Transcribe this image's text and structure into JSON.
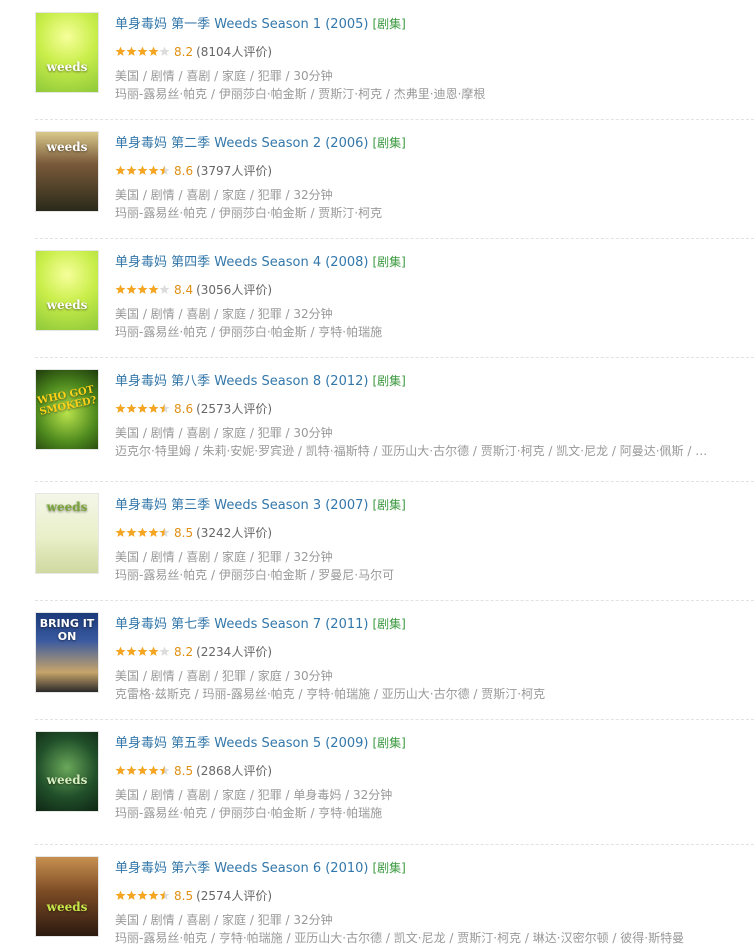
{
  "colors": {
    "title": "#3377aa",
    "tag": "#3b9940",
    "score": "#e09015",
    "meta": "#999999",
    "star": "#f4a522"
  },
  "items": [
    {
      "title": "单身毒妈 第一季 Weeds Season 1 (2005)",
      "tag": "[剧集]",
      "stars": 4,
      "score": "8.2",
      "count": "(8104人评价)",
      "genre": "美国 / 剧情 / 喜剧 / 家庭 / 犯罪 / 30分钟",
      "cast": "玛丽-露易丝·帕克 / 伊丽莎白·帕金斯 / 贾斯汀·柯克 / 杰弗里·迪恩·摩根",
      "poster": "leaf-lime",
      "poster_text": "weeds"
    },
    {
      "title": "单身毒妈 第二季 Weeds Season 2 (2006)",
      "tag": "[剧集]",
      "stars": 4.5,
      "score": "8.6",
      "count": "(3797人评价)",
      "genre": "美国 / 剧情 / 喜剧 / 家庭 / 犯罪 / 32分钟",
      "cast": "玛丽-露易丝·帕克 / 伊丽莎白·帕金斯 / 贾斯汀·柯克",
      "poster": "group-dark",
      "poster_text": "weeds"
    },
    {
      "title": "单身毒妈 第四季 Weeds Season 4 (2008)",
      "tag": "[剧集]",
      "stars": 4,
      "score": "8.4",
      "count": "(3056人评价)",
      "genre": "美国 / 剧情 / 喜剧 / 家庭 / 犯罪 / 32分钟",
      "cast": "玛丽-露易丝·帕克 / 伊丽莎白·帕金斯 / 亨特·帕瑞施",
      "poster": "leaf-lime",
      "poster_text": "weeds"
    },
    {
      "title": "单身毒妈 第八季 Weeds Season 8 (2012)",
      "tag": "[剧集]",
      "stars": 4.5,
      "score": "8.6",
      "count": "(2573人评价)",
      "genre": "美国 / 剧情 / 喜剧 / 家庭 / 犯罪 / 30分钟",
      "cast": "迈克尔·特里姆 / 朱莉·安妮·罗宾逊 / 凯特·福斯特 / 亚历山大·古尔德 / 贾斯汀·柯克 / 凯文·尼龙 / 阿曼达·佩斯 / 瑞…",
      "poster": "green-smoke",
      "poster_text": "WHO GOT SMOKED?"
    },
    {
      "title": "单身毒妈 第三季 Weeds Season 3 (2007)",
      "tag": "[剧集]",
      "stars": 4.5,
      "score": "8.5",
      "count": "(3242人评价)",
      "genre": "美国 / 剧情 / 喜剧 / 家庭 / 犯罪 / 32分钟",
      "cast": "玛丽-露易丝·帕克 / 伊丽莎白·帕金斯 / 罗曼尼·马尔可",
      "poster": "white-group",
      "poster_text": "weeds"
    },
    {
      "title": "单身毒妈 第七季 Weeds Season 7 (2011)",
      "tag": "[剧集]",
      "stars": 4,
      "score": "8.2",
      "count": "(2234人评价)",
      "genre": "美国 / 剧情 / 喜剧 / 犯罪 / 家庭 / 30分钟",
      "cast": "克雷格·兹斯克 / 玛丽-露易丝·帕克 / 亨特·帕瑞施 / 亚历山大·古尔德 / 贾斯汀·柯克",
      "poster": "bring-it",
      "poster_text": "BRING IT ON"
    },
    {
      "title": "单身毒妈 第五季 Weeds Season 5 (2009)",
      "tag": "[剧集]",
      "stars": 4.5,
      "score": "8.5",
      "count": "(2868人评价)",
      "genre": "美国 / 剧情 / 喜剧 / 家庭 / 犯罪 / 单身毒妈 / 32分钟",
      "cast": "玛丽-露易丝·帕克 / 伊丽莎白·帕金斯 / 亨特·帕瑞施",
      "poster": "dark-green",
      "poster_text": "weeds"
    },
    {
      "title": "单身毒妈 第六季 Weeds Season 6 (2010)",
      "tag": "[剧集]",
      "stars": 4.5,
      "score": "8.5",
      "count": "(2574人评价)",
      "genre": "美国 / 剧情 / 喜剧 / 家庭 / 犯罪 / 32分钟",
      "cast": "玛丽-露易丝·帕克 / 亨特·帕瑞施 / 亚历山大·古尔德 / 凯文·尼龙 / 贾斯汀·柯克 / 琳达·汉密尔顿 / 彼得·斯特曼",
      "poster": "brown-group",
      "poster_text": "weeds"
    }
  ]
}
